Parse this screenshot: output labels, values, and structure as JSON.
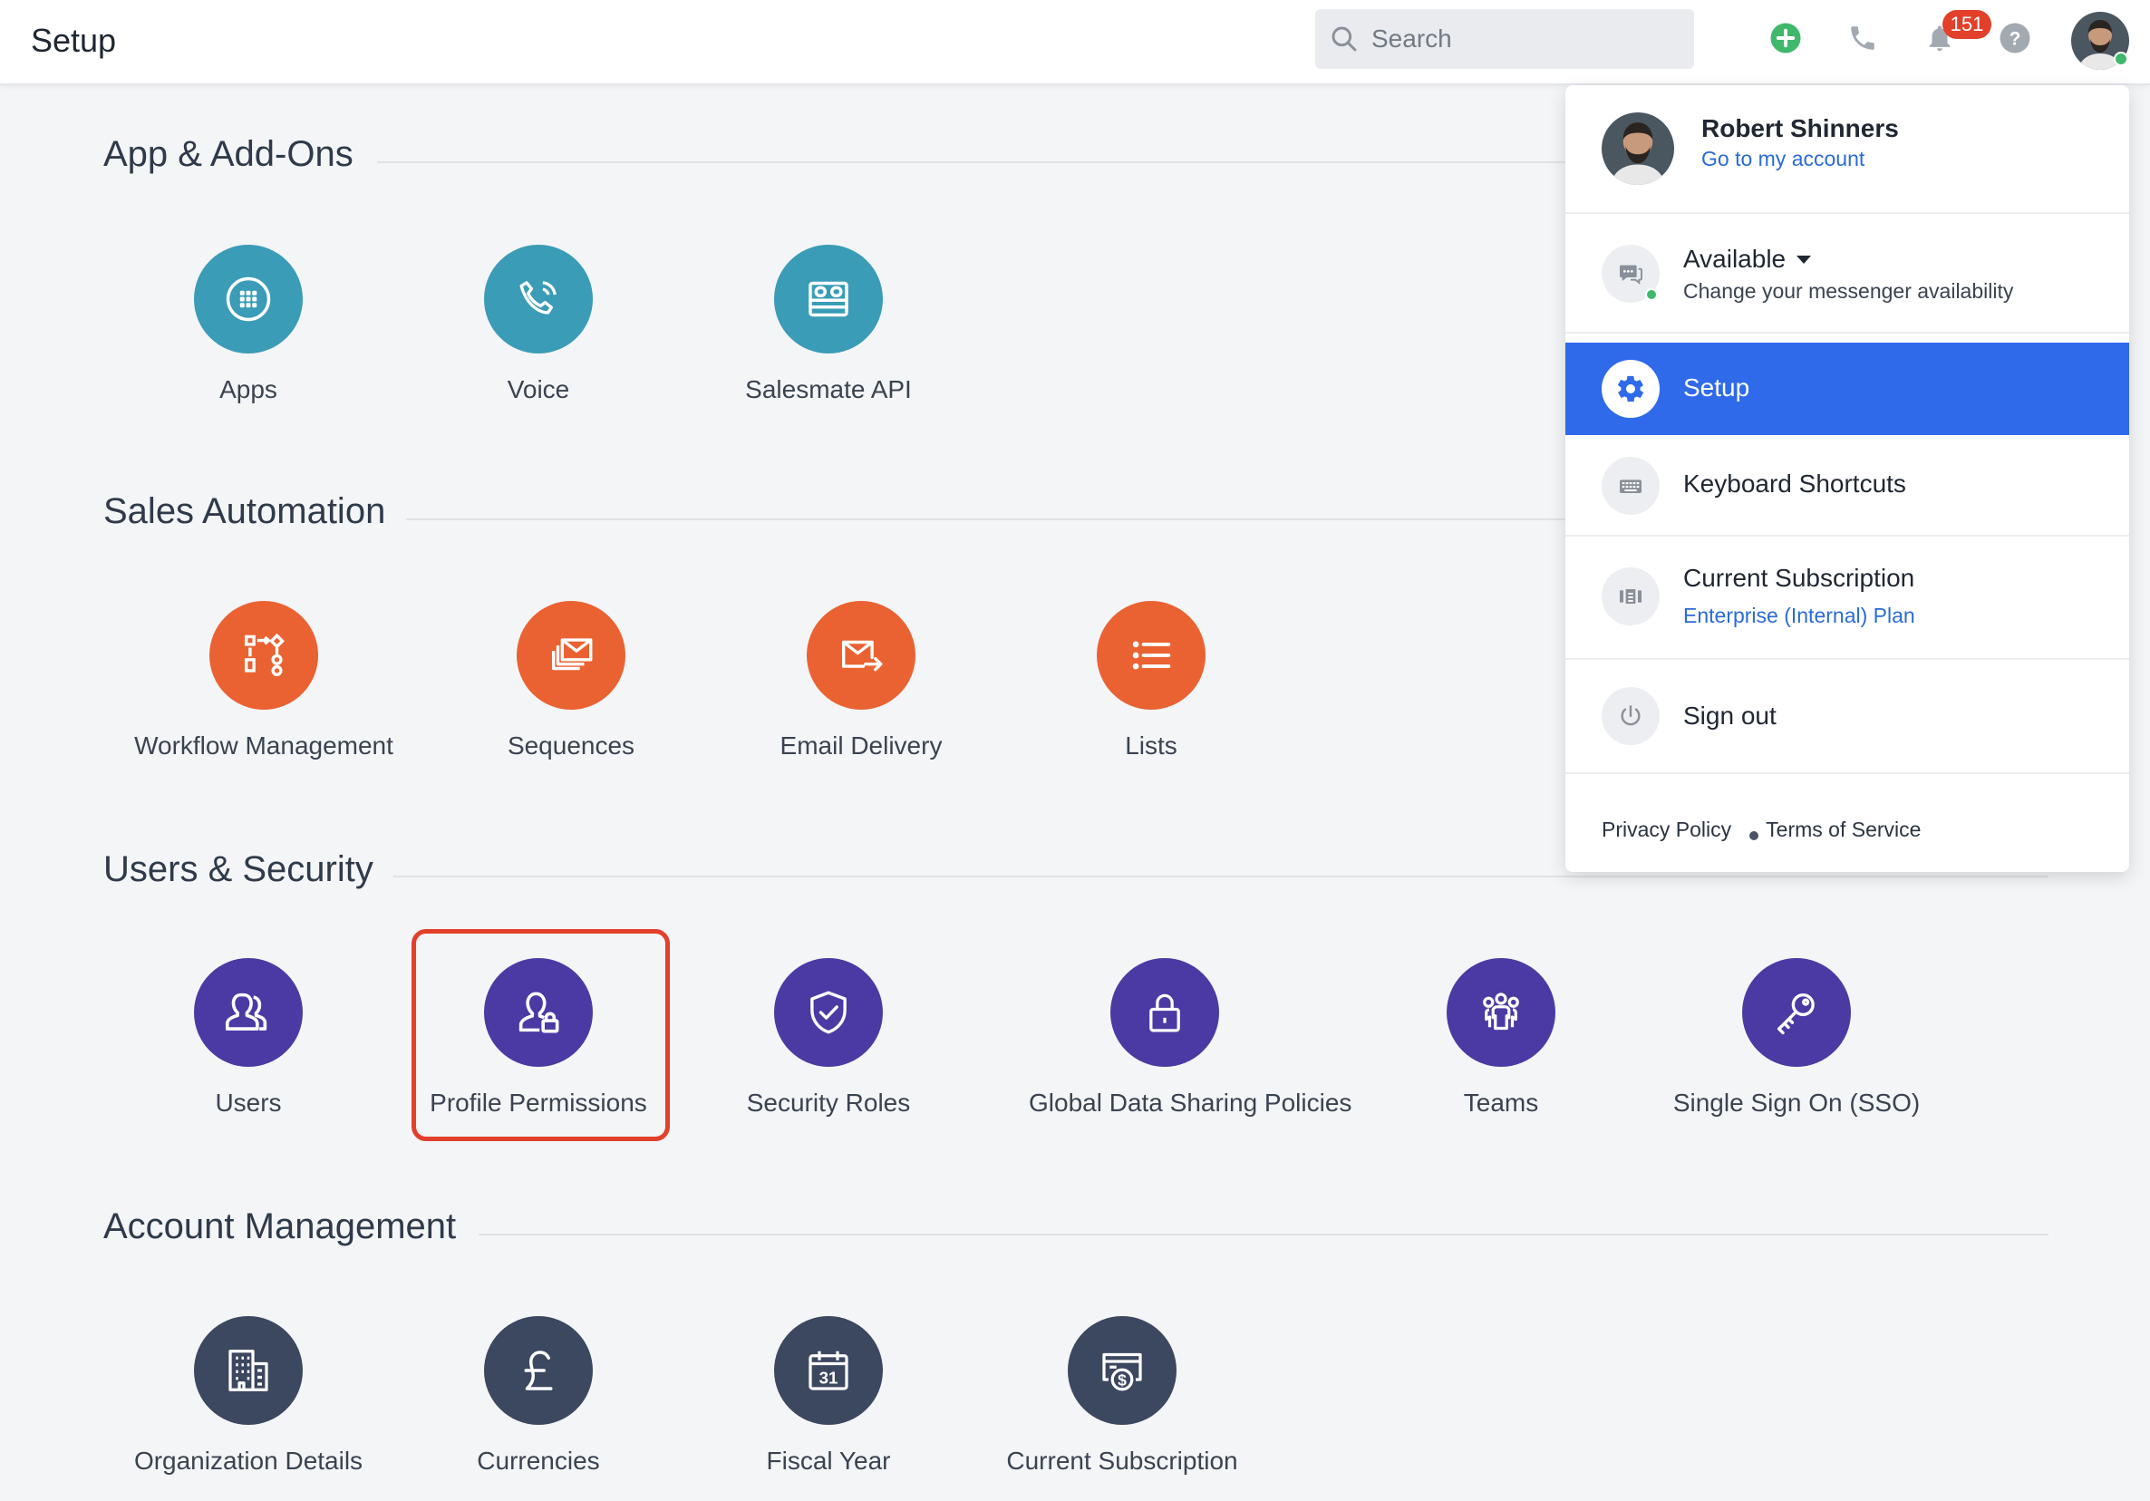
{
  "header": {
    "title": "Setup",
    "search_placeholder": "Search",
    "notifications_count": "151"
  },
  "sections": [
    {
      "title": "App & Add-Ons",
      "items": [
        {
          "label": "Apps",
          "icon": "grid-icon"
        },
        {
          "label": "Voice",
          "icon": "phone-icon"
        },
        {
          "label": "Salesmate API",
          "icon": "api-icon"
        }
      ]
    },
    {
      "title": "Sales Automation",
      "items": [
        {
          "label": "Workflow Management",
          "icon": "workflow-icon"
        },
        {
          "label": "Sequences",
          "icon": "envelope-stack-icon"
        },
        {
          "label": "Email Delivery",
          "icon": "email-send-icon"
        },
        {
          "label": "Lists",
          "icon": "list-icon"
        }
      ]
    },
    {
      "title": "Users & Security",
      "items": [
        {
          "label": "Users",
          "icon": "users-icon"
        },
        {
          "label": "Profile Permissions",
          "icon": "user-lock-icon"
        },
        {
          "label": "Security Roles",
          "icon": "shield-check-icon"
        },
        {
          "label": "Global Data Sharing Policies",
          "icon": "lock-icon"
        },
        {
          "label": "Teams",
          "icon": "team-icon"
        },
        {
          "label": "Single Sign On (SSO)",
          "icon": "key-icon"
        }
      ]
    },
    {
      "title": "Account Management",
      "items": [
        {
          "label": "Organization Details",
          "icon": "building-icon"
        },
        {
          "label": "Currencies",
          "icon": "pound-icon"
        },
        {
          "label": "Fiscal Year",
          "icon": "calendar-icon"
        },
        {
          "label": "Current Subscription",
          "icon": "billing-icon"
        }
      ]
    }
  ],
  "dropdown": {
    "user_name": "Robert Shinners",
    "account_link": "Go to my account",
    "availability_status": "Available",
    "availability_hint": "Change your messenger availability",
    "setup": "Setup",
    "keyboard_shortcuts": "Keyboard Shortcuts",
    "subscription_title": "Current Subscription",
    "subscription_plan": "Enterprise (Internal) Plan",
    "sign_out": "Sign out",
    "privacy_policy": "Privacy Policy",
    "terms_of_service": "Terms of Service"
  },
  "colors": {
    "teal": "#3a9cb6",
    "orange": "#ea6232",
    "purple": "#4b3aa3",
    "navy": "#3c4760",
    "accent_blue": "#2f6aea",
    "highlight_red": "#e2402b",
    "online_green": "#3fb86c"
  }
}
